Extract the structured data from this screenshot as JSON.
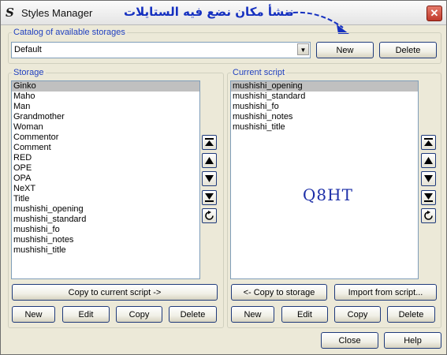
{
  "window": {
    "title": "Styles Manager",
    "close_glyph": "✕"
  },
  "annotation": {
    "text": "ننشأ مكان نضع فيه الستايلات",
    "color": "#1530c0"
  },
  "catalog": {
    "legend": "Catalog of available storages",
    "selected": "Default",
    "new_label": "New",
    "delete_label": "Delete"
  },
  "storage": {
    "legend": "Storage",
    "items": [
      "Ginko",
      "Maho",
      "Man",
      "Grandmother",
      "Woman",
      "Commentor",
      "Comment",
      "RED",
      "OPE",
      "OPA",
      "NeXT",
      "Title",
      "mushishi_opening",
      "mushishi_standard",
      "mushishi_fo",
      "mushishi_notes",
      "mushishi_title"
    ],
    "selected_index": 0,
    "copy_label": "Copy to current script ->",
    "new_label": "New",
    "edit_label": "Edit",
    "copy2_label": "Copy",
    "delete_label": "Delete"
  },
  "current": {
    "legend": "Current script",
    "items": [
      "mushishi_opening",
      "mushishi_standard",
      "mushishi_fo",
      "mushishi_notes",
      "mushishi_title"
    ],
    "selected_index": 0,
    "copy_label": "<- Copy to storage",
    "import_label": "Import from script...",
    "new_label": "New",
    "edit_label": "Edit",
    "copy2_label": "Copy",
    "delete_label": "Delete"
  },
  "watermark": "Q8HT",
  "footer": {
    "close_label": "Close",
    "help_label": "Help"
  },
  "icons": {
    "app": "styles-s-icon",
    "move": [
      "move-top-icon",
      "move-up-icon",
      "move-down-icon",
      "move-bottom-icon",
      "sort-icon"
    ]
  },
  "colors": {
    "legend": "#2040c0",
    "annotation": "#1530c0",
    "selection": "#c0c0c0",
    "watermark": "#1d2fa8"
  }
}
